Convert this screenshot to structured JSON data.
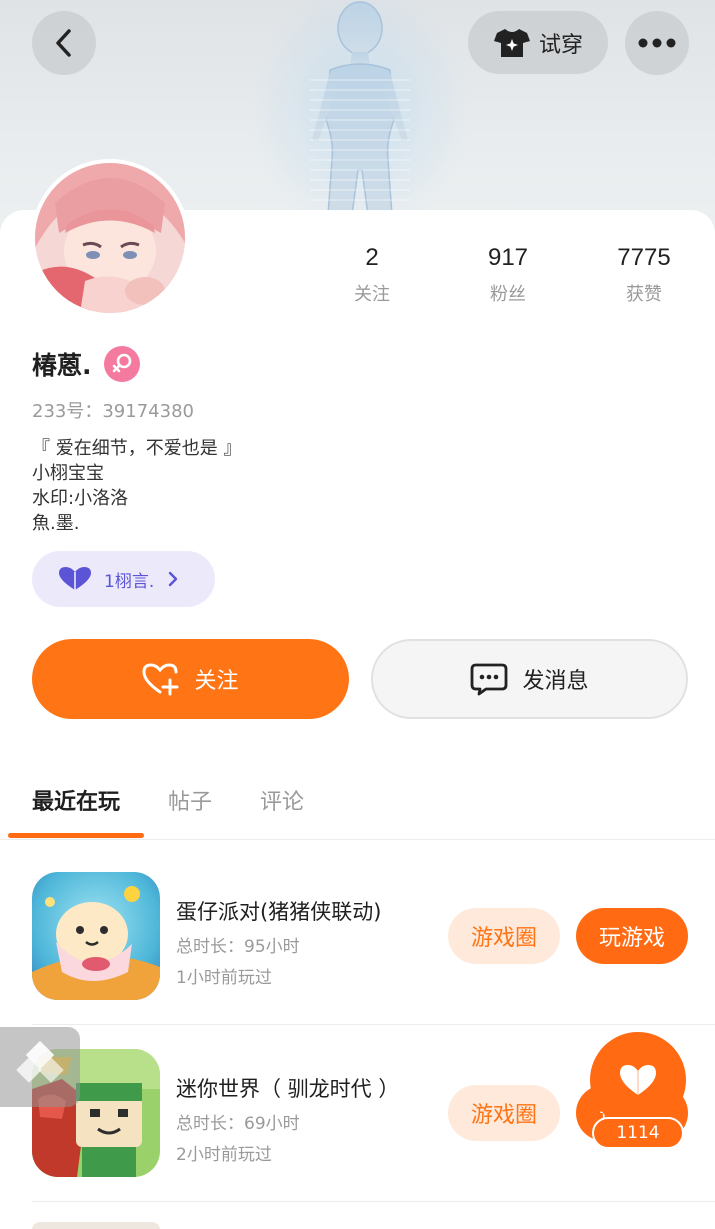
{
  "header": {
    "try_on_label": "试穿"
  },
  "stats": [
    {
      "value": "2",
      "label": "关注"
    },
    {
      "value": "917",
      "label": "粉丝"
    },
    {
      "value": "7775",
      "label": "获赞"
    }
  ],
  "profile": {
    "name": "椿蒽.",
    "uid": "233号：39174380",
    "bio_lines": [
      "『 爱在细节，不爱也是 』",
      "小栩宝宝",
      "水印:小洛洛",
      "魚.墨."
    ],
    "group_pill_label": "1栩言."
  },
  "actions": {
    "follow_label": "关注",
    "message_label": "发消息"
  },
  "tabs": [
    {
      "label": "最近在玩",
      "active": true
    },
    {
      "label": "帖子",
      "active": false
    },
    {
      "label": "评论",
      "active": false
    }
  ],
  "games": [
    {
      "title": "蛋仔派对(猪猪侠联动)",
      "duration": "总时长：95小时",
      "last_played": "1小时前玩过",
      "circle_label": "游戏圈",
      "play_label": "玩游戏"
    },
    {
      "title": "迷你世界（ 驯龙时代 ）",
      "duration": "总时长：69小时",
      "last_played": "2小时前玩过",
      "circle_label": "游戏圈",
      "play_label": "玩游戏"
    }
  ],
  "float_like": {
    "count": "1114"
  },
  "colors": {
    "accent": "#ff6a13",
    "accent_light": "#ffe9da",
    "group_pill_bg": "#ece9fb",
    "group_pill_text": "#5b54d6",
    "gender_badge": "#f47aa0"
  }
}
